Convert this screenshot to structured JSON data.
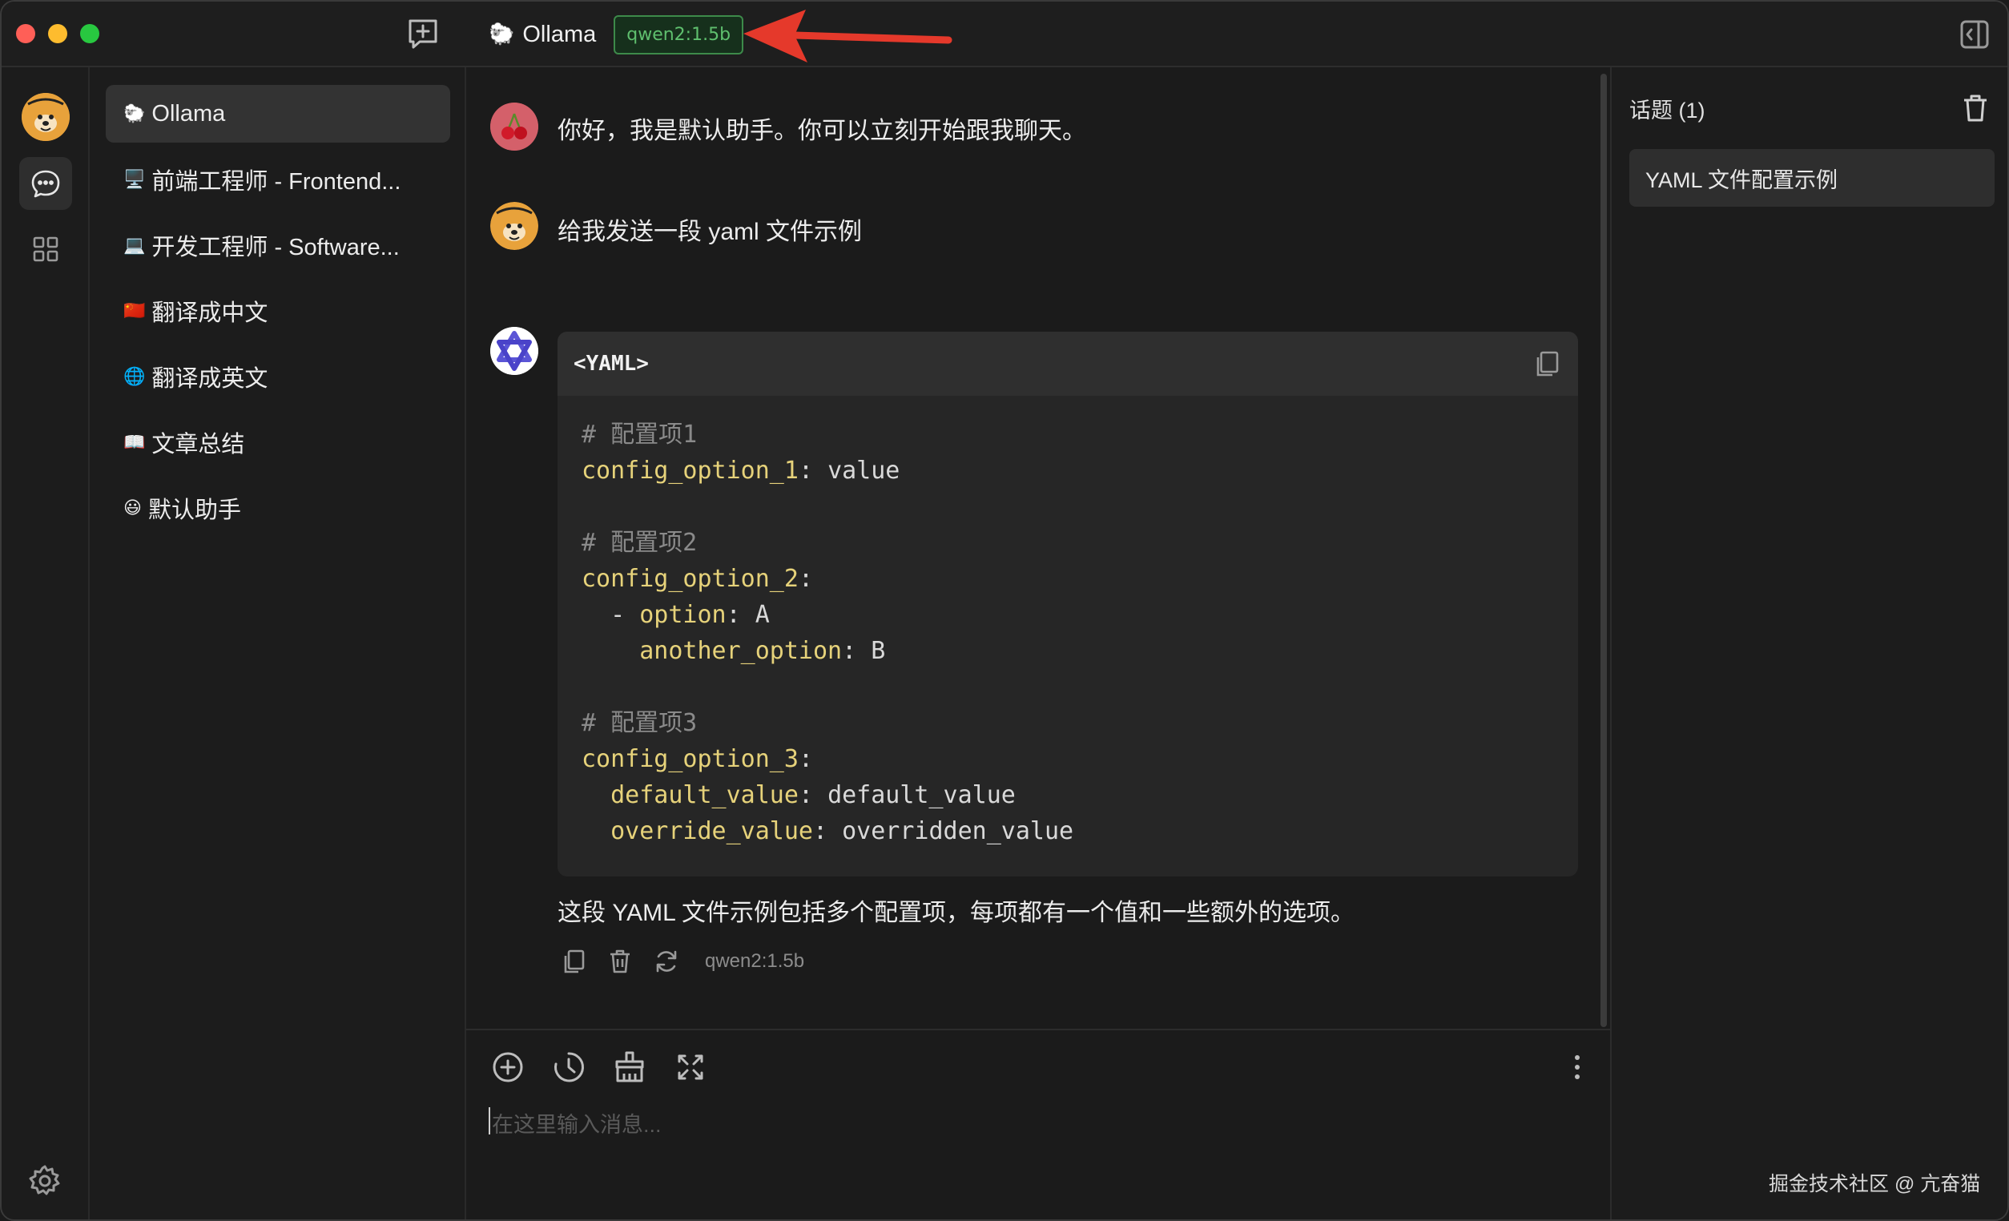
{
  "window": {
    "title": "Ollama",
    "title_emoji": "🐑",
    "model_tag": "qwen2:1.5b"
  },
  "agents": [
    {
      "emoji": "🐑",
      "label": "Ollama",
      "active": true
    },
    {
      "emoji": "🖥️",
      "label": "前端工程师 - Frontend..."
    },
    {
      "emoji": "💻",
      "label": "开发工程师 - Software..."
    },
    {
      "emoji": "🇨🇳",
      "label": "翻译成中文"
    },
    {
      "emoji": "🌐",
      "label": "翻译成英文"
    },
    {
      "emoji": "📖",
      "label": "文章总结"
    },
    {
      "emoji": "😃",
      "label": "默认助手"
    }
  ],
  "chat": {
    "greeting": "你好，我是默认助手。你可以立刻开始跟我聊天。",
    "greeting_avatar": "🍒",
    "user_message": "给我发送一段 yaml 文件示例",
    "code_lang": "<YAML>",
    "code_lines": [
      {
        "c": "# 配置项1"
      },
      {
        "k": "config_option_1",
        "v": "value"
      },
      {
        "blank": true
      },
      {
        "c": "# 配置项2"
      },
      {
        "k": "config_option_2",
        "v": ""
      },
      {
        "indent": "  ",
        "dash": "- ",
        "k": "option",
        "v": "A"
      },
      {
        "indent": "    ",
        "k": "another_option",
        "v": "B"
      },
      {
        "blank": true
      },
      {
        "c": "# 配置项3"
      },
      {
        "k": "config_option_3",
        "v": ""
      },
      {
        "indent": "  ",
        "k": "default_value",
        "v": "default_value"
      },
      {
        "indent": "  ",
        "k": "override_value",
        "v": "overridden_value"
      }
    ],
    "assistant_summary": "这段 YAML 文件示例包括多个配置项，每项都有一个值和一些额外的选项。",
    "assistant_model": "qwen2:1.5b"
  },
  "input": {
    "placeholder": "在这里输入消息..."
  },
  "topics": {
    "title": "话题 (1)",
    "items": [
      "YAML 文件配置示例"
    ]
  },
  "watermark": "掘金技术社区 @ 亢奋猫",
  "icons": {
    "new_chat": "new-chat-icon",
    "panel_toggle": "sidebar-toggle-icon",
    "chat": "chat-bubble-icon",
    "apps": "grid-icon",
    "settings": "gear-icon",
    "copy": "copy-icon",
    "delete": "trash-icon",
    "regenerate": "refresh-icon",
    "add": "plus-circle-icon",
    "history": "history-icon",
    "clear": "broom-icon",
    "expand": "expand-icon",
    "more": "more-vertical-icon"
  },
  "colors": {
    "background": "#1b1b1b",
    "model_tag_text": "#5fbf6e",
    "arrow": "#e5392b",
    "code_key": "#e6d27a"
  }
}
